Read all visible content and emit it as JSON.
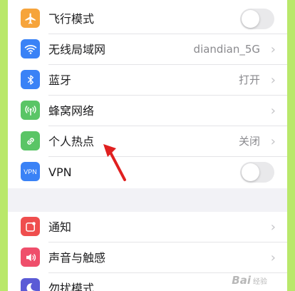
{
  "group1": [
    {
      "label": "飞行模式",
      "icon": "airplane-icon",
      "color": "#f6a43b",
      "control": "toggle",
      "toggle_on": false
    },
    {
      "label": "无线局域网",
      "icon": "wifi-icon",
      "color": "#3a82f6",
      "value": "diandian_5G",
      "control": "chevron"
    },
    {
      "label": "蓝牙",
      "icon": "bluetooth-icon",
      "color": "#3a82f6",
      "value": "打开",
      "control": "chevron"
    },
    {
      "label": "蜂窝网络",
      "icon": "cellular-icon",
      "color": "#5ac566",
      "control": "chevron"
    },
    {
      "label": "个人热点",
      "icon": "hotspot-icon",
      "color": "#5ac566",
      "value": "关闭",
      "control": "chevron"
    },
    {
      "label": "VPN",
      "icon": "vpn-icon",
      "color": "#3a82f6",
      "icon_text": "VPN",
      "control": "toggle",
      "toggle_on": false
    }
  ],
  "group2": [
    {
      "label": "通知",
      "icon": "notifications-icon",
      "color": "#ef4e4e",
      "control": "chevron"
    },
    {
      "label": "声音与触感",
      "icon": "sounds-icon",
      "color": "#ef4e6b",
      "control": "chevron"
    },
    {
      "label": "勿扰模式",
      "icon": "do-not-disturb-icon",
      "color": "#5b5bd6"
    }
  ],
  "chevron_glyph": "›",
  "watermark": {
    "text": "Bai",
    "sub": "经验"
  },
  "annotation_color": "#e02020",
  "background_color": "#b9e86a"
}
